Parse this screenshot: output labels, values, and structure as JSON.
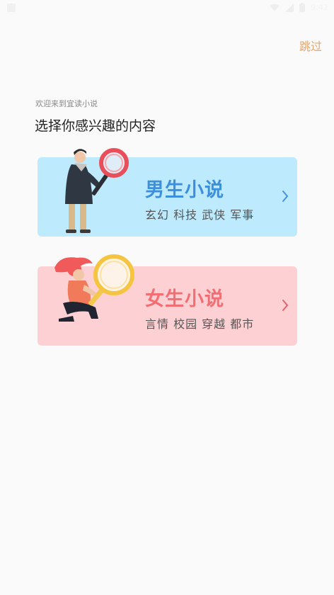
{
  "status_bar": {
    "time": "9:42",
    "icons": [
      "app-notification-icon",
      "wifi-icon",
      "cell-signal-icon",
      "battery-icon"
    ]
  },
  "header": {
    "skip_label": "跳过",
    "welcome": "欢迎来到宜读小说",
    "headline": "选择你感兴趣的内容"
  },
  "categories": [
    {
      "title": "男生小说",
      "tags": "玄幻 科技 武侠 军事",
      "colors": {
        "background": "#bdeafc",
        "title": "#3c8fdc",
        "chevron": "#4a90d9"
      },
      "illustration": "man-with-magnifier"
    },
    {
      "title": "女生小说",
      "tags": "言情 校园 穿越 都市",
      "colors": {
        "background": "#fdd1d3",
        "title": "#f26e73",
        "chevron": "#e0636a"
      },
      "illustration": "woman-with-magnifier"
    }
  ],
  "colors": {
    "page_background": "#fafafa",
    "skip_text": "#e0a672"
  }
}
